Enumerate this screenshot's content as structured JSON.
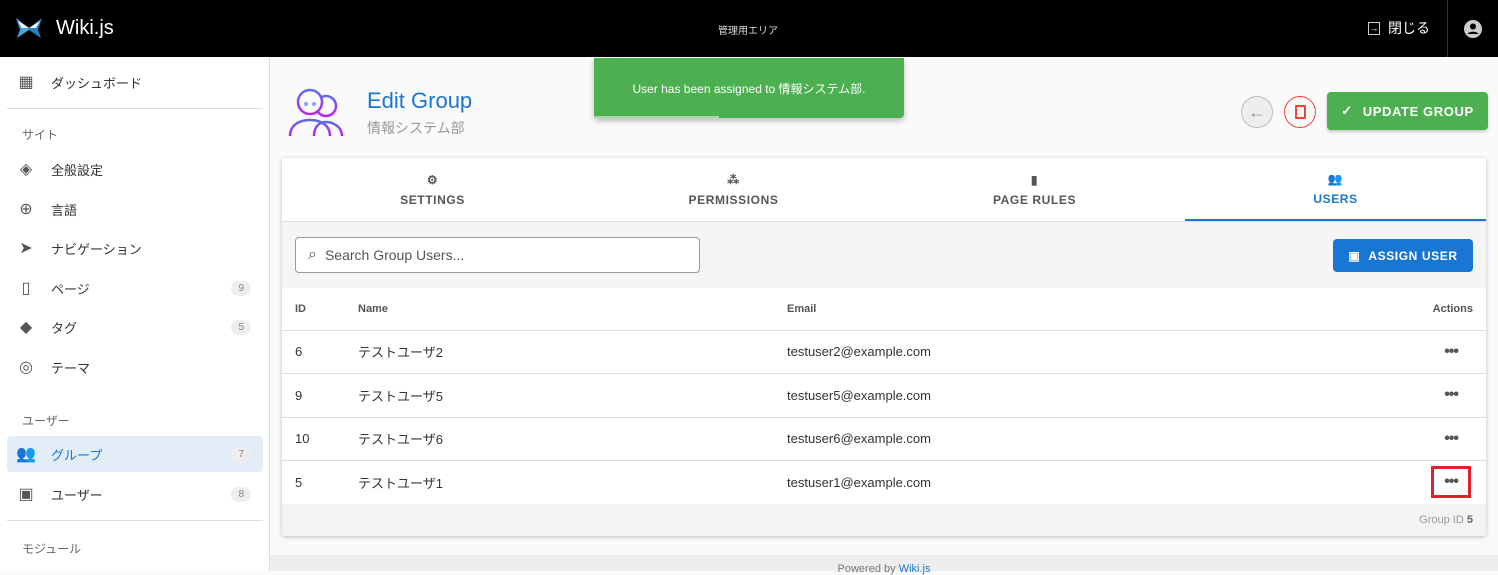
{
  "header": {
    "brand": "Wiki.js",
    "area": "管理用エリア",
    "close_label": "閉じる"
  },
  "sidebar": {
    "dashboard": "ダッシュボード",
    "section_site": "サイト",
    "items": [
      {
        "label": "全般設定",
        "icon": "widgets-icon"
      },
      {
        "label": "言語",
        "icon": "globe-icon"
      },
      {
        "label": "ナビゲーション",
        "icon": "navigation-icon"
      },
      {
        "label": "ページ",
        "icon": "page-icon",
        "count": "9"
      },
      {
        "label": "タグ",
        "icon": "tag-icon",
        "count": "5"
      },
      {
        "label": "テーマ",
        "icon": "palette-icon"
      }
    ],
    "section_users": "ユーザー",
    "user_items": [
      {
        "label": "グループ",
        "icon": "groups-icon",
        "count": "7",
        "active": true
      },
      {
        "label": "ユーザー",
        "icon": "user-icon",
        "count": "8"
      }
    ],
    "section_modules": "モジュール"
  },
  "toast": {
    "message": "User has been assigned to 情報システム部.",
    "color": "#4caf50"
  },
  "page": {
    "title": "Edit Group",
    "subtitle": "情報システム部",
    "update_label": "UPDATE GROUP"
  },
  "tabs": [
    {
      "label": "SETTINGS"
    },
    {
      "label": "PERMISSIONS"
    },
    {
      "label": "PAGE RULES"
    },
    {
      "label": "USERS",
      "active": true
    }
  ],
  "users": {
    "search_placeholder": "Search Group Users...",
    "assign_label": "ASSIGN USER",
    "columns": [
      "ID",
      "Name",
      "Email",
      "Actions"
    ],
    "rows": [
      {
        "id": "6",
        "name": "テストユーザ2",
        "email": "testuser2@example.com"
      },
      {
        "id": "9",
        "name": "テストユーザ5",
        "email": "testuser5@example.com"
      },
      {
        "id": "10",
        "name": "テストユーザ6",
        "email": "testuser6@example.com"
      },
      {
        "id": "5",
        "name": "テストユーザ1",
        "email": "testuser1@example.com"
      }
    ],
    "actions_glyph": "•••",
    "group_id_label": "Group ID",
    "group_id": "5"
  },
  "footer": {
    "powered_by": "Powered by",
    "link": "Wiki.js"
  },
  "colors": {
    "primary": "#1976d2",
    "success": "#4caf50",
    "danger": "#f44336"
  }
}
